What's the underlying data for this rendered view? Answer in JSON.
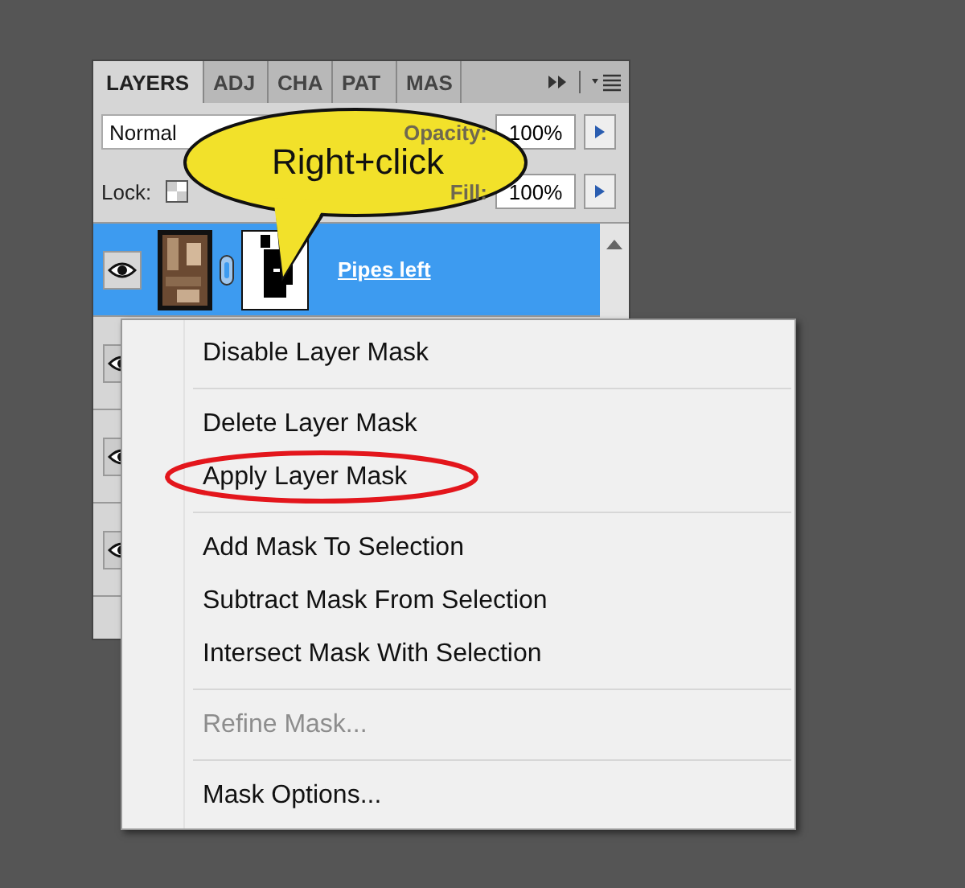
{
  "panel": {
    "tabs": [
      {
        "label": "LAYERS",
        "selected": true
      },
      {
        "label": "ADJ",
        "selected": false
      },
      {
        "label": "CHA",
        "selected": false
      },
      {
        "label": "PAT",
        "selected": false
      },
      {
        "label": "MAS",
        "selected": false
      }
    ],
    "blend_mode": "Normal",
    "opacity_label": "Opacity:",
    "opacity": "100%",
    "lock_label": "Lock:",
    "fill_label": "Fill:",
    "fill": "100%",
    "layers": [
      {
        "name": "Pipes left",
        "selected": true,
        "visible": true
      },
      {
        "selected": false,
        "visible": true
      },
      {
        "selected": false,
        "visible": true
      },
      {
        "selected": false,
        "visible": true
      }
    ]
  },
  "callout": {
    "text": "Right+click"
  },
  "context_menu": {
    "groups": [
      [
        {
          "label": "Disable Layer Mask",
          "disabled": false,
          "circled": false
        }
      ],
      [
        {
          "label": "Delete Layer Mask",
          "disabled": false,
          "circled": false
        },
        {
          "label": "Apply Layer Mask",
          "disabled": false,
          "circled": true
        }
      ],
      [
        {
          "label": "Add Mask To Selection",
          "disabled": false,
          "circled": false
        },
        {
          "label": "Subtract Mask From Selection",
          "disabled": false,
          "circled": false
        },
        {
          "label": "Intersect Mask With Selection",
          "disabled": false,
          "circled": false
        }
      ],
      [
        {
          "label": "Refine Mask...",
          "disabled": true,
          "circled": false
        }
      ],
      [
        {
          "label": "Mask Options...",
          "disabled": false,
          "circled": false
        }
      ]
    ]
  }
}
